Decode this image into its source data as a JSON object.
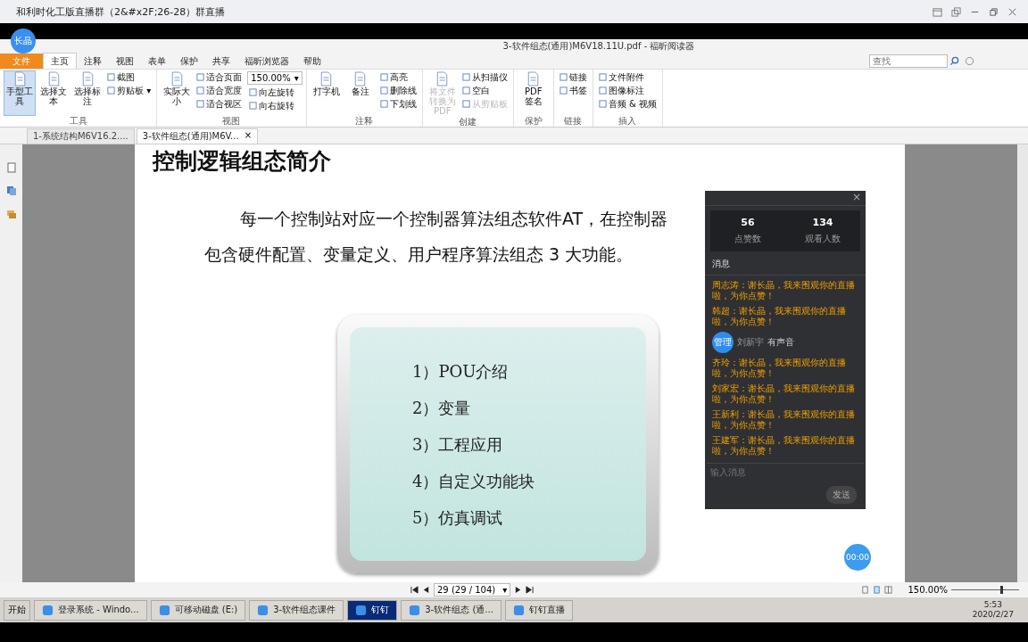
{
  "window": {
    "title": "和利时化工版直播群（2&#x2F;26-28）群直播",
    "presenter": "长晶"
  },
  "reader": {
    "title": "3-软件组态(通用)M6V18.11U.pdf - 福昕阅读器",
    "menu": [
      {
        "label": "文件",
        "selected": false,
        "kind": "file"
      },
      {
        "label": "主页",
        "selected": true,
        "kind": "tab"
      },
      {
        "label": "注释",
        "selected": false,
        "kind": "tab"
      },
      {
        "label": "视图",
        "selected": false,
        "kind": "tab"
      },
      {
        "label": "表单",
        "selected": false,
        "kind": "tab"
      },
      {
        "label": "保护",
        "selected": false,
        "kind": "tab"
      },
      {
        "label": "共享",
        "selected": false,
        "kind": "tab"
      },
      {
        "label": "福昕浏览器",
        "selected": false,
        "kind": "tab"
      },
      {
        "label": "帮助",
        "selected": false,
        "kind": "tab"
      }
    ],
    "search": {
      "placeholder": "查找"
    },
    "ribbon": [
      {
        "name": "工具",
        "items": [
          {
            "kind": "large",
            "label": "手型工具",
            "selected": true,
            "disabled": false
          },
          {
            "kind": "large",
            "label": "选择文本",
            "selected": false,
            "disabled": false
          },
          {
            "kind": "large",
            "label": "选择标注",
            "selected": false,
            "disabled": false
          },
          {
            "kind": "small",
            "label": "截图",
            "selected": false,
            "disabled": false
          },
          {
            "kind": "small",
            "label": "剪贴板 ▾",
            "selected": false,
            "disabled": false
          }
        ]
      },
      {
        "name": "视图",
        "items": [
          {
            "kind": "large",
            "label": "实际大小",
            "selected": false,
            "disabled": false
          },
          {
            "kind": "small",
            "label": "适合页面",
            "selected": false,
            "disabled": false
          },
          {
            "kind": "small",
            "label": "适合宽度",
            "selected": false,
            "disabled": false
          },
          {
            "kind": "small",
            "label": "适合视区",
            "selected": false,
            "disabled": false
          },
          {
            "kind": "zoom",
            "label": "150.00%",
            "caret": "▾"
          },
          {
            "kind": "small",
            "label": "向左旋转",
            "selected": false,
            "disabled": false
          },
          {
            "kind": "small",
            "label": "向右旋转",
            "selected": false,
            "disabled": false
          }
        ]
      },
      {
        "name": "注释",
        "items": [
          {
            "kind": "large",
            "label": "打字机",
            "selected": false,
            "disabled": false
          },
          {
            "kind": "large",
            "label": "备注",
            "selected": false,
            "disabled": false
          },
          {
            "kind": "small",
            "label": "高亮",
            "selected": false,
            "disabled": false
          },
          {
            "kind": "small",
            "label": "删除线",
            "selected": false,
            "disabled": false
          },
          {
            "kind": "small",
            "label": "下划线",
            "selected": false,
            "disabled": false
          }
        ]
      },
      {
        "name": "创建",
        "items": [
          {
            "kind": "large",
            "label": "将文件转换为PDF",
            "selected": false,
            "disabled": true
          },
          {
            "kind": "small",
            "label": "从扫描仪",
            "selected": false,
            "disabled": false
          },
          {
            "kind": "small",
            "label": "空白",
            "selected": false,
            "disabled": false
          },
          {
            "kind": "small",
            "label": "从剪贴板",
            "selected": false,
            "disabled": true
          }
        ]
      },
      {
        "name": "保护",
        "items": [
          {
            "kind": "large",
            "label": "PDF 签名",
            "selected": false,
            "disabled": false
          }
        ]
      },
      {
        "name": "链接",
        "items": [
          {
            "kind": "small",
            "label": "链接",
            "selected": false,
            "disabled": false
          },
          {
            "kind": "small",
            "label": "书签",
            "selected": false,
            "disabled": false
          }
        ]
      },
      {
        "name": "插入",
        "items": [
          {
            "kind": "small",
            "label": "文件附件",
            "selected": false,
            "disabled": false
          },
          {
            "kind": "small",
            "label": "图像标注",
            "selected": false,
            "disabled": false
          },
          {
            "kind": "small",
            "label": "音频 & 视频",
            "selected": false,
            "disabled": false
          }
        ]
      }
    ],
    "doc_tabs": [
      {
        "label": "1-系统结构M6V16.2....",
        "selected": false
      },
      {
        "label": "3-软件组态(通用)M6V...",
        "selected": true,
        "close": "×"
      }
    ],
    "page": {
      "heading": "控制逻辑组态简介",
      "paragraph_lines": [
        "每一个控制站对应一个控制器算法组态软件AT，在控制器",
        "包含硬件配置、变量定义、用户程序算法组态 3 大功能。"
      ],
      "list": [
        "1）POU介绍",
        "2）变量",
        "3）工程应用",
        "4）自定义功能块",
        "5）仿真调试"
      ]
    },
    "status_bar": {
      "page_field": "29 (29 / 104)",
      "page_caret": "▾",
      "zoom": "150.00%",
      "zoom_slider": {
        "level": 0.72
      }
    }
  },
  "live_panel": {
    "close": "×",
    "stats": [
      {
        "value": "56",
        "label": "点赞数"
      },
      {
        "value": "134",
        "label": "观看人数"
      }
    ],
    "header": "消息",
    "messages": [
      {
        "kind": "message",
        "text": "周志涛：谢长晶，我来围观你的直播啦，为你点赞！"
      },
      {
        "kind": "message",
        "text": "韩超：谢长晶，我来围观你的直播啦，为你点赞！"
      },
      {
        "kind": "join",
        "badge": "管理",
        "name": "刘新宇",
        "text": "有声音"
      },
      {
        "kind": "message",
        "text": "齐玲：谢长晶，我来围观你的直播啦，为你点赞！"
      },
      {
        "kind": "message",
        "text": "刘家宏：谢长晶，我来围观你的直播啦，为你点赞！"
      },
      {
        "kind": "message",
        "text": "王新利：谢长晶，我来围观你的直播啦，为你点赞！"
      },
      {
        "kind": "message",
        "text": "王建军：谢长晶，我来围观你的直播啦，为你点赞！"
      }
    ],
    "input": {
      "placeholder": "输入消息"
    },
    "send": "发送",
    "timer": "00:00"
  },
  "taskbar": {
    "start": "开始",
    "items": [
      {
        "label": "登录系统 - Windo...",
        "selected": false
      },
      {
        "label": "可移动磁盘 (E:)",
        "selected": false
      },
      {
        "label": "3-软件组态课件",
        "selected": false
      },
      {
        "label": "钉钉",
        "selected": true
      },
      {
        "label": "3-软件组态 (通...",
        "selected": false
      },
      {
        "label": "钉钉直播",
        "selected": false
      }
    ],
    "time": "5:53",
    "date": "2020/2/27"
  }
}
